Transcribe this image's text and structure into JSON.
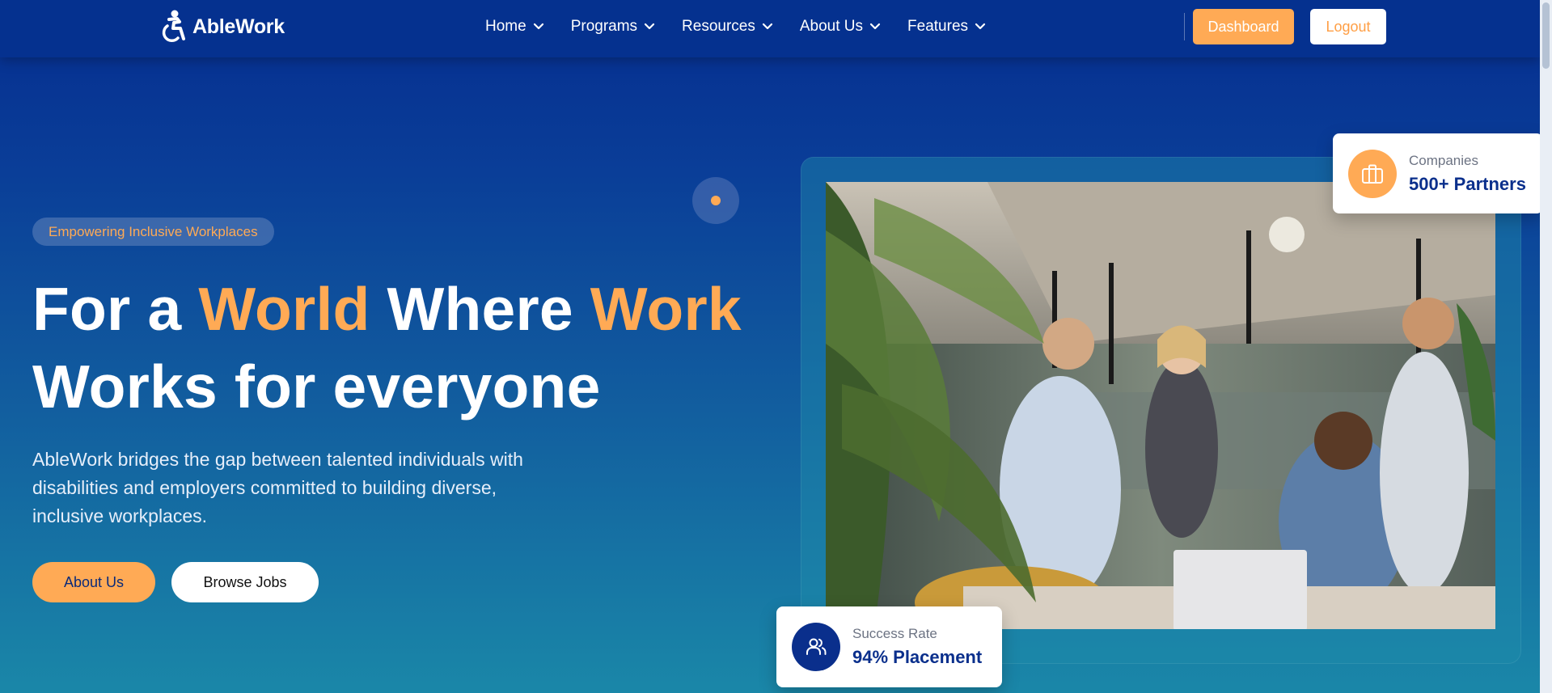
{
  "brand": {
    "name": "AbleWork",
    "logo_icon": "accessible-icon"
  },
  "nav": {
    "items": [
      {
        "label": "Home"
      },
      {
        "label": "Programs"
      },
      {
        "label": "Resources"
      },
      {
        "label": "About Us"
      },
      {
        "label": "Features"
      }
    ],
    "dashboard_label": "Dashboard",
    "logout_label": "Logout"
  },
  "hero": {
    "badge": "Empowering Inclusive Workplaces",
    "title": {
      "part1": "For a ",
      "accent1": "World",
      "part2": " Where ",
      "accent2": "Work",
      "line2": "Works for everyone"
    },
    "description": "AbleWork bridges the gap between talented individuals with disabilities and employers committed to building diverse, inclusive workplaces.",
    "primary_button": "About Us",
    "secondary_button": "Browse Jobs"
  },
  "stats": {
    "companies": {
      "label": "Companies",
      "value": "500+ Partners",
      "icon": "briefcase-icon"
    },
    "success": {
      "label": "Success Rate",
      "value": "94% Placement",
      "icon": "users-icon"
    }
  },
  "colors": {
    "accent": "#ffaa55",
    "navy": "#0a2f8c",
    "nav_bg": "#05318f"
  }
}
